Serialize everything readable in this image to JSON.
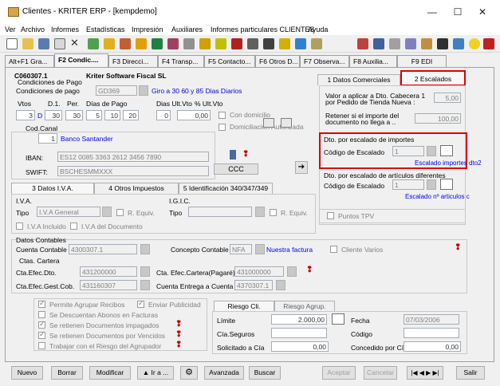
{
  "window": {
    "title": "Clientes - KRITER ERP - [kempdemo]",
    "minimize": "—",
    "maximize": "☐",
    "close": "✕"
  },
  "menu": [
    "Ver",
    "Archivo",
    "Informes",
    "Estadísticas",
    "Impresión",
    "Auxiliares",
    "Informes particulares CLIENTES",
    "Ayuda"
  ],
  "tabs": [
    "Alt+F1 Gra...",
    "F2 Condic....",
    "F3 Direcci...",
    "F4 Transp...",
    "F5 Contacto...",
    "F6 Otros D...",
    "F7 Observa...",
    "F8 Auxilia...",
    "F9 EDI"
  ],
  "header": {
    "code": "C060307.1",
    "name": "Kriter Software Fiscal SL"
  },
  "payment": {
    "group_label": "Condiciones de Pago",
    "cond_label": "Condiciones de pago",
    "cond_value": "GD369",
    "cond_desc": "Giro a 30 60 y 85 Dias Diarios",
    "vtos_label": "Vtos",
    "d1_label": "D.1.",
    "per_label": "Per.",
    "dias_label": "Días de Pago",
    "dias_ult_label": "Dias Ult.Vto",
    "pct_ult_label": "% Ult.Vto",
    "vtos_value": "3",
    "d_value": "D",
    "d1_value": "30",
    "per_value": "30",
    "dia1": "5",
    "dia2": "10",
    "dia3": "20",
    "dias_ult_value": "0",
    "pct_ult_value": "0,00",
    "con_domicilio": "Con domicilio",
    "domiciliacion": "Domiciliacion Autorizada",
    "canal_label": "Cod.Canal",
    "canal_value": "1",
    "canal_desc": "Banco Santander",
    "iban_label": "IBAN:",
    "iban_value": "ES12 0085 3363 2612 3456 7890",
    "swift_label": "SWIFT:",
    "swift_value": "BSCHESMMXXX",
    "ccc_button": "CCC",
    "arrow_button": "➔"
  },
  "right_tabs": {
    "tab1": "1 Datos Comerciales",
    "tab2": "2 Escalados"
  },
  "escalados": {
    "valor_label1": "Valor a aplicar a Dto. Cabecera 1",
    "valor_label2": "por Pedido de Tienda Nueva :",
    "valor_value": "5,00",
    "retener_label1": "Retener si el importe del",
    "retener_label2": "documento no llega a ..",
    "retener_value": "100,00",
    "dto_imp_group": "Dto. por escalado de importes",
    "cod_esc_label": "Código de Escalado",
    "cod_esc_value": "1",
    "esc_imp_link": "Escalado importes dto2",
    "dto_art_group": "Dto. por escalado de artículos diferentes",
    "cod_esc2_label": "Código de Escalado",
    "cod_esc2_value": "1",
    "esc_art_link": "Escalado nº articulos c",
    "puntos_tpv": "Puntos TPV"
  },
  "mid_tabs": [
    "3 Datos I.V.A.",
    "4 Otros Impuestos",
    "5 Identificación 340/347/349"
  ],
  "iva": {
    "iva_group": "I.V.A.",
    "tipo_label": "Tipo",
    "tipo_value": "I.V.A General",
    "requiv": "R. Equiv.",
    "igic_group": "I.G.I.C.",
    "igic_tipo_label": "Tipo",
    "igic_requiv": "R. Equiv.",
    "iva_incluido": "I.V.A Incluido",
    "iva_documento": "I.V.A del Documento"
  },
  "contables": {
    "group": "Datos Contables",
    "cuenta_label": "Cuenta Contable",
    "cuenta_value": "4300307.1",
    "concepto_label": "Concepto Contable",
    "concepto_value": "NFA",
    "concepto_desc": "Nuestra factura",
    "cliente_varios": "Cliente Varios",
    "ctas_group": "Ctas. Cartera",
    "efec_dto_label": "Cta.Efec.Dto.",
    "efec_dto_value": "431200000",
    "efec_pag_label": "Cta. Efec.Cartera(Pagaré)",
    "efec_pag_value": "431000000",
    "efec_gest_label": "Cta.Efec.Gest.Cob.",
    "efec_gest_value": "431160307",
    "entrega_label": "Cuenta Entrega a Cuenta",
    "entrega_value": "4370307.1"
  },
  "options": {
    "permite": "Permite Agrupar Recibos",
    "enviar": "Enviar Publicidad",
    "descuentan": "Se Descuentan Abonos en Facturas",
    "retienen_imp": "Se retienen Documentos impagados",
    "retienen_venc": "Se retienen Documentos por Vencidos",
    "trabajar": "Trabajar con el Riesgo del Agrupador"
  },
  "riesgo": {
    "tab1": "Riesgo Cli.",
    "tab2": "Riesgo Agrup.",
    "limite_label": "Límite",
    "limite_value": "2.000,00",
    "fecha_label": "Fecha",
    "fecha_value": "07/03/2006",
    "cia_label": "Cía.Seguros",
    "codigo_label": "Código",
    "solicitado_label": "Solicitado a Cía",
    "solicitado_value": "0,00",
    "concedido_label": "Concedido por Cía",
    "concedido_value": "0,00"
  },
  "buttons": {
    "nuevo": "Nuevo",
    "borrar": "Borrar",
    "modificar": "Modificar",
    "ira": "▲ Ir a ...",
    "avanzada": "Avanzada",
    "buscar": "Buscar",
    "aceptar": "Aceptar",
    "cancelar": "Cancelar",
    "nav": "|◀ ◀ ▶ ▶|",
    "salir": "Salir"
  },
  "colors": {
    "accent_red": "#e00000",
    "link_blue": "#0000ee"
  }
}
